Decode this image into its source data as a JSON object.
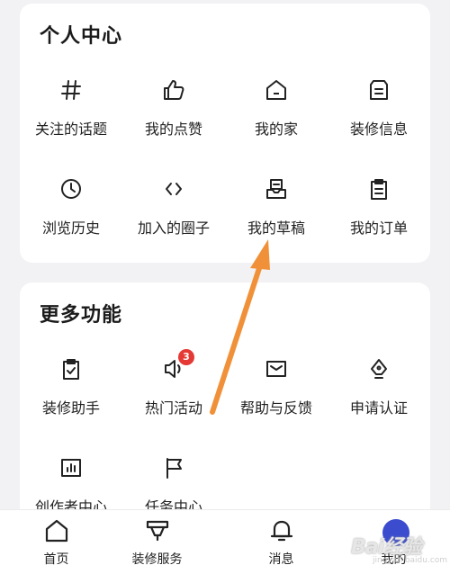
{
  "personal_center": {
    "title": "个人中心",
    "items": [
      {
        "label": "关注的话题",
        "icon": "hashtag-icon"
      },
      {
        "label": "我的点赞",
        "icon": "thumbs-up-icon"
      },
      {
        "label": "我的家",
        "icon": "home-icon"
      },
      {
        "label": "装修信息",
        "icon": "info-card-icon"
      },
      {
        "label": "浏览历史",
        "icon": "clock-icon"
      },
      {
        "label": "加入的圈子",
        "icon": "code-brackets-icon"
      },
      {
        "label": "我的草稿",
        "icon": "draft-tray-icon"
      },
      {
        "label": "我的订单",
        "icon": "clipboard-icon"
      }
    ]
  },
  "more_features": {
    "title": "更多功能",
    "items": [
      {
        "label": "装修助手",
        "icon": "clipboard-check-icon"
      },
      {
        "label": "热门活动",
        "icon": "megaphone-icon",
        "badge": "3"
      },
      {
        "label": "帮助与反馈",
        "icon": "mail-icon"
      },
      {
        "label": "申请认证",
        "icon": "pen-nib-icon"
      },
      {
        "label": "创作者中心",
        "icon": "bar-chart-icon"
      },
      {
        "label": "任务中心",
        "icon": "flag-icon"
      }
    ]
  },
  "bottom_nav": {
    "items": [
      {
        "label": "首页",
        "icon": "home-icon"
      },
      {
        "label": "装修服务",
        "icon": "funnel-cup-icon"
      },
      {
        "label": "消息",
        "icon": "bell-icon"
      },
      {
        "label": "我的",
        "icon": "avatar-icon"
      }
    ]
  },
  "watermark": {
    "text": "Bai经验",
    "sub": "jingyan.baidu.com"
  },
  "colors": {
    "accent_arrow": "#f0913a",
    "badge": "#e53935",
    "background": "#f2f2f4"
  }
}
